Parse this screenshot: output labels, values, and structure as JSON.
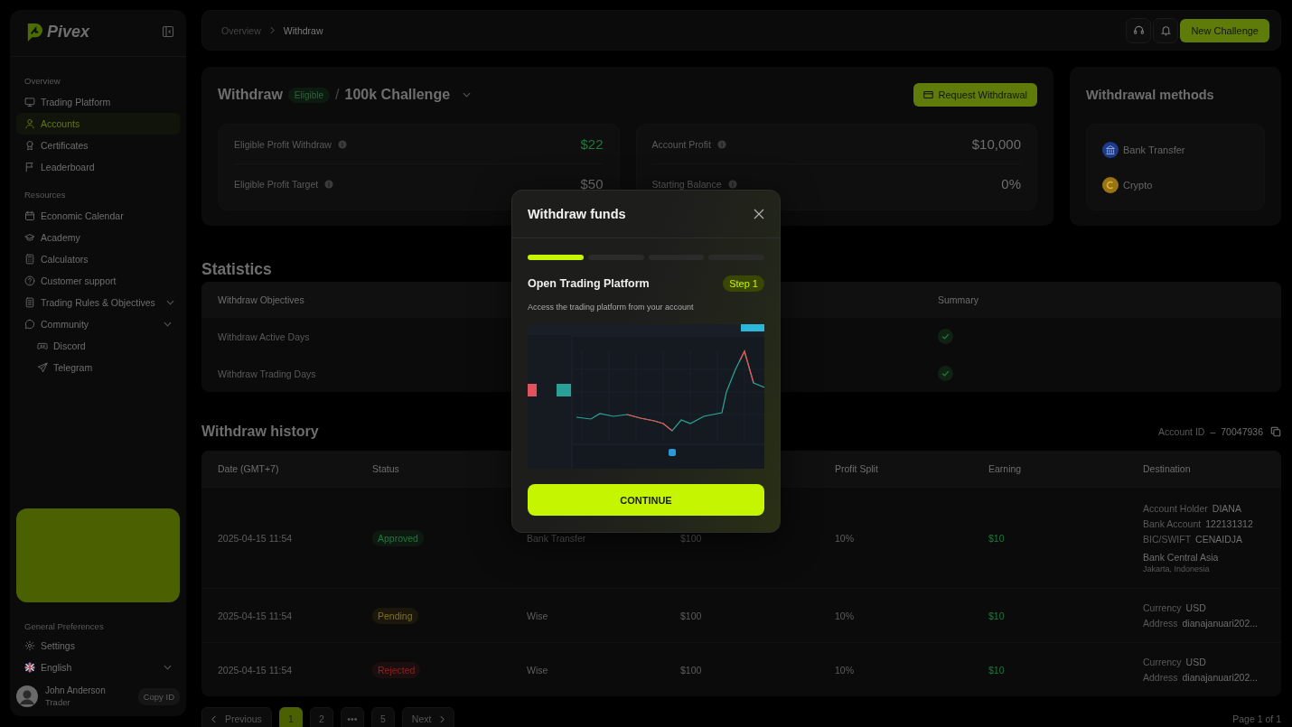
{
  "sidebar": {
    "brand": "Pivex",
    "sections": [
      {
        "title": "Overview",
        "items": [
          {
            "label": "Trading Platform",
            "selected": false
          },
          {
            "label": "Accounts",
            "selected": true
          },
          {
            "label": "Certificates",
            "selected": false
          },
          {
            "label": "Leaderboard",
            "selected": false
          }
        ]
      },
      {
        "title": "Resources",
        "items": [
          {
            "label": "Economic Calendar",
            "selected": false
          },
          {
            "label": "Academy",
            "selected": false
          },
          {
            "label": "Calculators",
            "selected": false
          },
          {
            "label": "Customer support",
            "selected": false
          },
          {
            "label": "Trading Rules & Objectives",
            "selected": false,
            "has_submenu": true
          },
          {
            "label": "Community",
            "selected": false,
            "has_submenu": true,
            "children": [
              {
                "label": "Discord",
                "selected": false
              },
              {
                "label": "Telegram",
                "selected": false
              }
            ]
          }
        ]
      }
    ],
    "preferences": {
      "title": "General Preferences",
      "items": [
        {
          "label": "Settings",
          "kind": "link"
        },
        {
          "label": "English",
          "kind": "dropdown"
        }
      ]
    },
    "user": {
      "name": "John Anderson",
      "role": "Trader",
      "action": "Copy ID"
    }
  },
  "topbar": {
    "breadcrumb": [
      "Overview",
      "Withdraw"
    ],
    "primary_button": "New Challenge"
  },
  "withdraw": {
    "title": "Withdraw",
    "status": "Eligible",
    "separator": "/",
    "account": "100k Challenge",
    "action": "Request Withdrawal",
    "stat_groups": [
      [
        {
          "label": "Eligible Profit Withdraw",
          "value": "$22",
          "highlighted": true
        },
        {
          "label": "Eligible Profit Target",
          "value": "$50",
          "highlighted": false
        }
      ],
      [
        {
          "label": "Account Profit",
          "value": "$10,000",
          "highlighted": false
        },
        {
          "label": "Starting Balance",
          "value": "0%",
          "highlighted": false
        }
      ]
    ]
  },
  "methods": {
    "title": "Withdrawal methods",
    "items": [
      {
        "label": "Bank Transfer",
        "color": "#1d3b8c"
      },
      {
        "label": "Crypto",
        "color": "#9a7410"
      }
    ]
  },
  "statistics": {
    "title": "Statistics",
    "columns": [
      "Withdraw Objectives",
      "Summary"
    ],
    "rows": [
      {
        "objective": "Withdraw Active Days",
        "passed": true
      },
      {
        "objective": "Withdraw Trading Days",
        "passed": true
      }
    ]
  },
  "history": {
    "title": "Withdraw history",
    "account_label": "Account ID",
    "separator": "–",
    "account_id": "70047936",
    "columns": [
      "Date (GMT+7)",
      "Status",
      "Profit Split",
      "Earning",
      "Destination"
    ],
    "rows": [
      {
        "date": "2025-04-15 11:54",
        "status": "Approved",
        "color": "#1f7a3a",
        "method": "Bank Transfer",
        "amount": "$100",
        "profit_split": "10%",
        "earning": "$10",
        "destination": [
          {
            "label": "Account Holder",
            "value": "DIANA"
          },
          {
            "label": "Bank Account",
            "value": "122131312"
          },
          {
            "label": "BIC/SWIFT",
            "value": "CENAIDJA"
          }
        ],
        "bank": {
          "name": "Bank Central Asia",
          "location": "Jakarta, Indonesia"
        }
      },
      {
        "date": "2025-04-15 11:54",
        "status": "Pending",
        "color": "#8a700f",
        "method": "Wise",
        "amount": "$100",
        "profit_split": "10%",
        "earning": "$10",
        "destination": [
          {
            "label": "Currency",
            "value": "USD"
          },
          {
            "label": "Address",
            "value": "dianajanuari202..."
          }
        ]
      },
      {
        "date": "2025-04-15 11:54",
        "status": "Rejected",
        "color": "#8a2222",
        "method": "Wise",
        "amount": "$100",
        "profit_split": "10%",
        "earning": "$10",
        "destination": [
          {
            "label": "Currency",
            "value": "USD"
          },
          {
            "label": "Address",
            "value": "dianajanuari202..."
          }
        ]
      }
    ]
  },
  "pagination": {
    "previous": "Previous",
    "next": "Next",
    "pages": [
      {
        "label": "1",
        "selected": true
      },
      {
        "label": "2",
        "selected": false
      },
      {
        "label": "•••",
        "selected": false
      },
      {
        "label": "5",
        "selected": false
      }
    ],
    "summary": "Page 1 of 1"
  },
  "modal": {
    "title": "Withdraw funds",
    "steps": [
      {
        "active": true
      },
      {
        "active": false
      },
      {
        "active": false
      },
      {
        "active": false
      }
    ],
    "step_title": "Open Trading Platform",
    "step_badge": "Step 1",
    "description": "Access the trading platform from your account",
    "button": "CONTINUE"
  }
}
